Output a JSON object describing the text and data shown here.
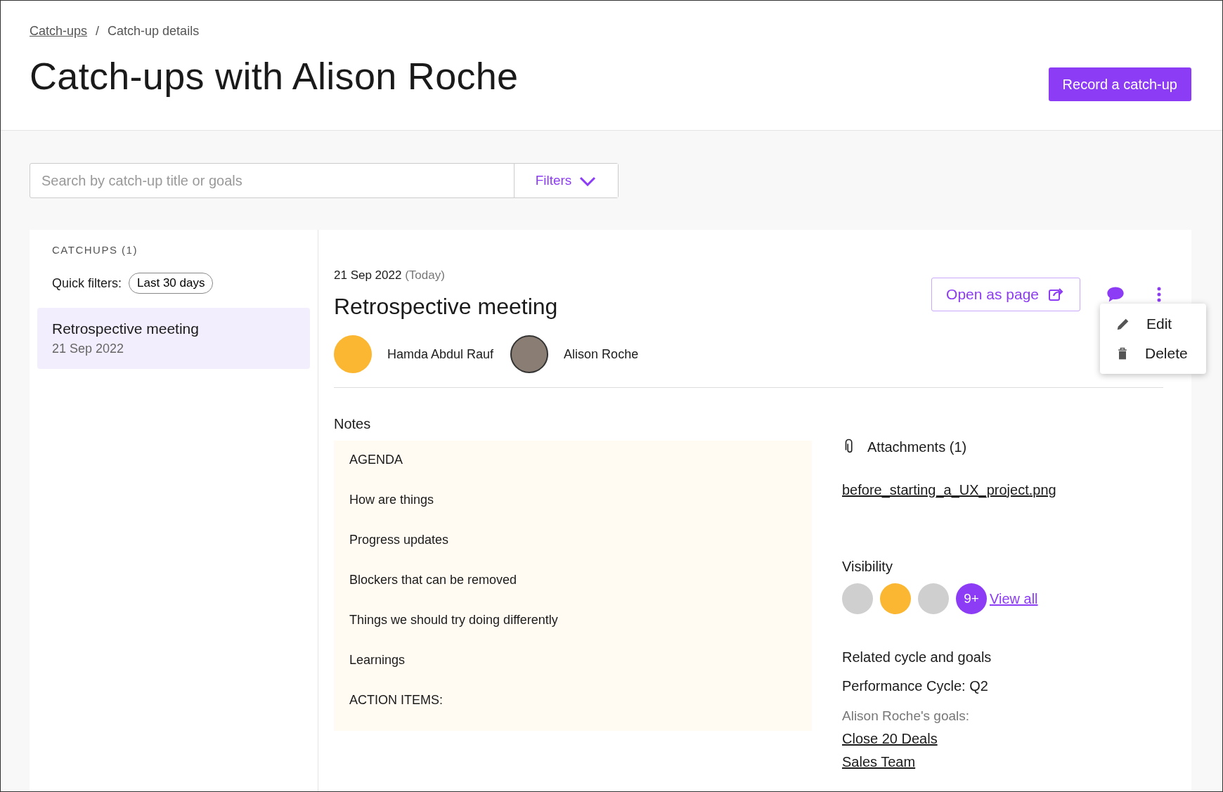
{
  "breadcrumb": [
    {
      "label": "Catch-ups",
      "kind": "link"
    },
    {
      "label": "Catch-up details",
      "kind": "current"
    }
  ],
  "breadcrumb_separator": "/",
  "title": "Catch-ups with Alison Roche",
  "primary_button": "Record a catch-up",
  "search": {
    "placeholder": "Search by catch-up title or goals"
  },
  "filters_button": "Filters",
  "sidebar": {
    "heading": "CATCHUPS (1)",
    "quick_filters_label": "Quick filters:",
    "quick_filters": [
      "Last 30 days"
    ],
    "items": [
      {
        "title": "Retrospective meeting",
        "date": "21 Sep 2022",
        "selected": true
      }
    ]
  },
  "detail": {
    "date": "21 Sep 2022",
    "date_note": "(Today)",
    "title": "Retrospective meeting",
    "open_button": "Open as page",
    "participants": [
      {
        "name": "Hamda Abdul Rauf",
        "kind": "illustration"
      },
      {
        "name": "Alison Roche",
        "kind": "photo"
      }
    ],
    "menu": [
      {
        "label": "Edit",
        "kind": "pencil"
      },
      {
        "label": "Delete",
        "kind": "trash"
      }
    ],
    "notes": {
      "heading": "Notes",
      "lines": [
        "AGENDA",
        "How are things",
        "Progress updates",
        "Blockers that can be removed",
        "Things we should try doing differently",
        "Learnings",
        "ACTION ITEMS:"
      ]
    },
    "attachments": {
      "heading": "Attachments (1)",
      "files": [
        "before_starting_a_UX_project.png"
      ]
    },
    "visibility": {
      "heading": "Visibility",
      "avatars": [
        {
          "kind": "photo"
        },
        {
          "kind": "illustration"
        },
        {
          "kind": "photo"
        }
      ],
      "more": "9+",
      "link": "View all"
    },
    "related": {
      "heading": "Related cycle and goals",
      "cycle": "Performance Cycle: Q2",
      "goals_label": "Alison Roche's goals:",
      "goals": [
        "Close 20 Deals",
        "Sales Team"
      ]
    }
  }
}
